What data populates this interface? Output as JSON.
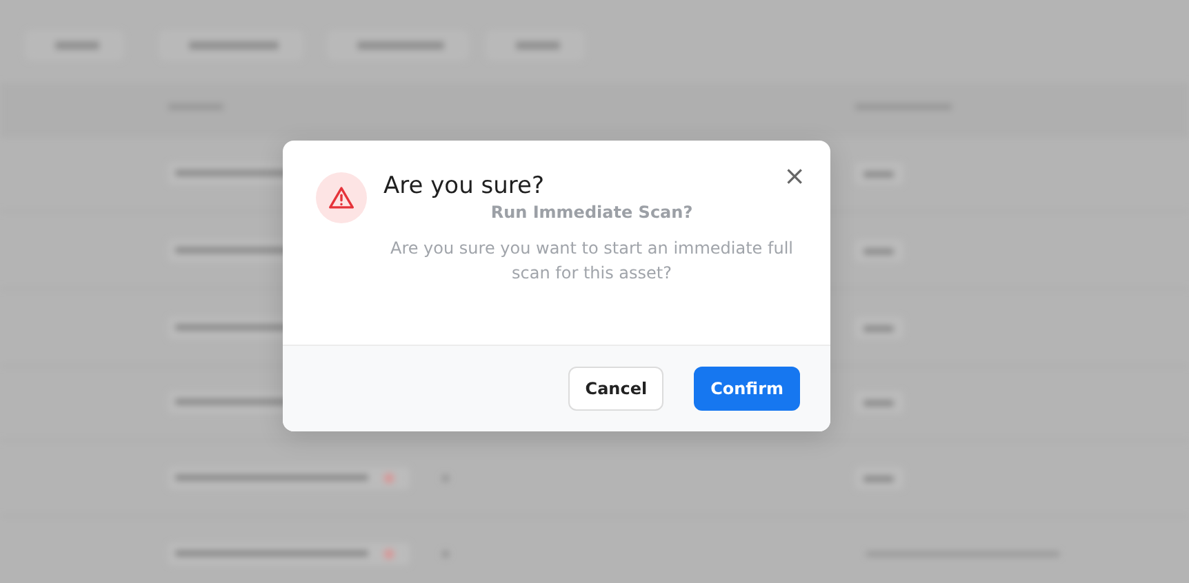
{
  "dialog": {
    "title": "Are you sure?",
    "subtitle": "Run Immediate Scan?",
    "message": "Are you sure you want to start an immediate full scan for this asset?",
    "close": "×",
    "buttons": [
      {
        "label": "Cancel",
        "kind": "secondary"
      },
      {
        "label": "Confirm",
        "kind": "primary"
      }
    ]
  }
}
